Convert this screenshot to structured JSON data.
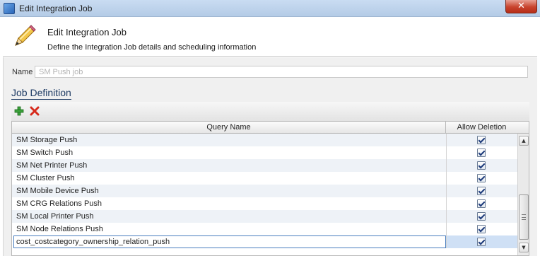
{
  "window": {
    "title": "Edit Integration Job",
    "close_glyph": "✕",
    "app_icon": "window-app-icon"
  },
  "header": {
    "title": "Edit Integration Job",
    "subtitle": "Define the Integration Job details and scheduling information",
    "icon": "pencil-icon"
  },
  "form": {
    "name_label": "Name",
    "name_value": "SM Push job",
    "name_placeholder": ""
  },
  "job_definition": {
    "title": "Job Definition",
    "add_icon": "add-icon",
    "delete_icon": "delete-icon",
    "columns": {
      "query_name": "Query Name",
      "allow_deletion": "Allow Deletion"
    },
    "rows": [
      {
        "name": "SM Storage Push",
        "allow_deletion": true
      },
      {
        "name": "SM Switch Push",
        "allow_deletion": true
      },
      {
        "name": "SM Net Printer Push",
        "allow_deletion": true
      },
      {
        "name": "SM Cluster Push",
        "allow_deletion": true
      },
      {
        "name": "SM Mobile Device Push",
        "allow_deletion": true
      },
      {
        "name": "SM CRG Relations Push",
        "allow_deletion": true
      },
      {
        "name": "SM Local Printer Push",
        "allow_deletion": true
      },
      {
        "name": "SM Node Relations Push",
        "allow_deletion": true
      },
      {
        "name": "cost_costcategory_ownership_relation_push",
        "allow_deletion": true,
        "selected": true
      }
    ]
  },
  "scrollbar": {
    "up_glyph": "▲",
    "down_glyph": "▼"
  }
}
